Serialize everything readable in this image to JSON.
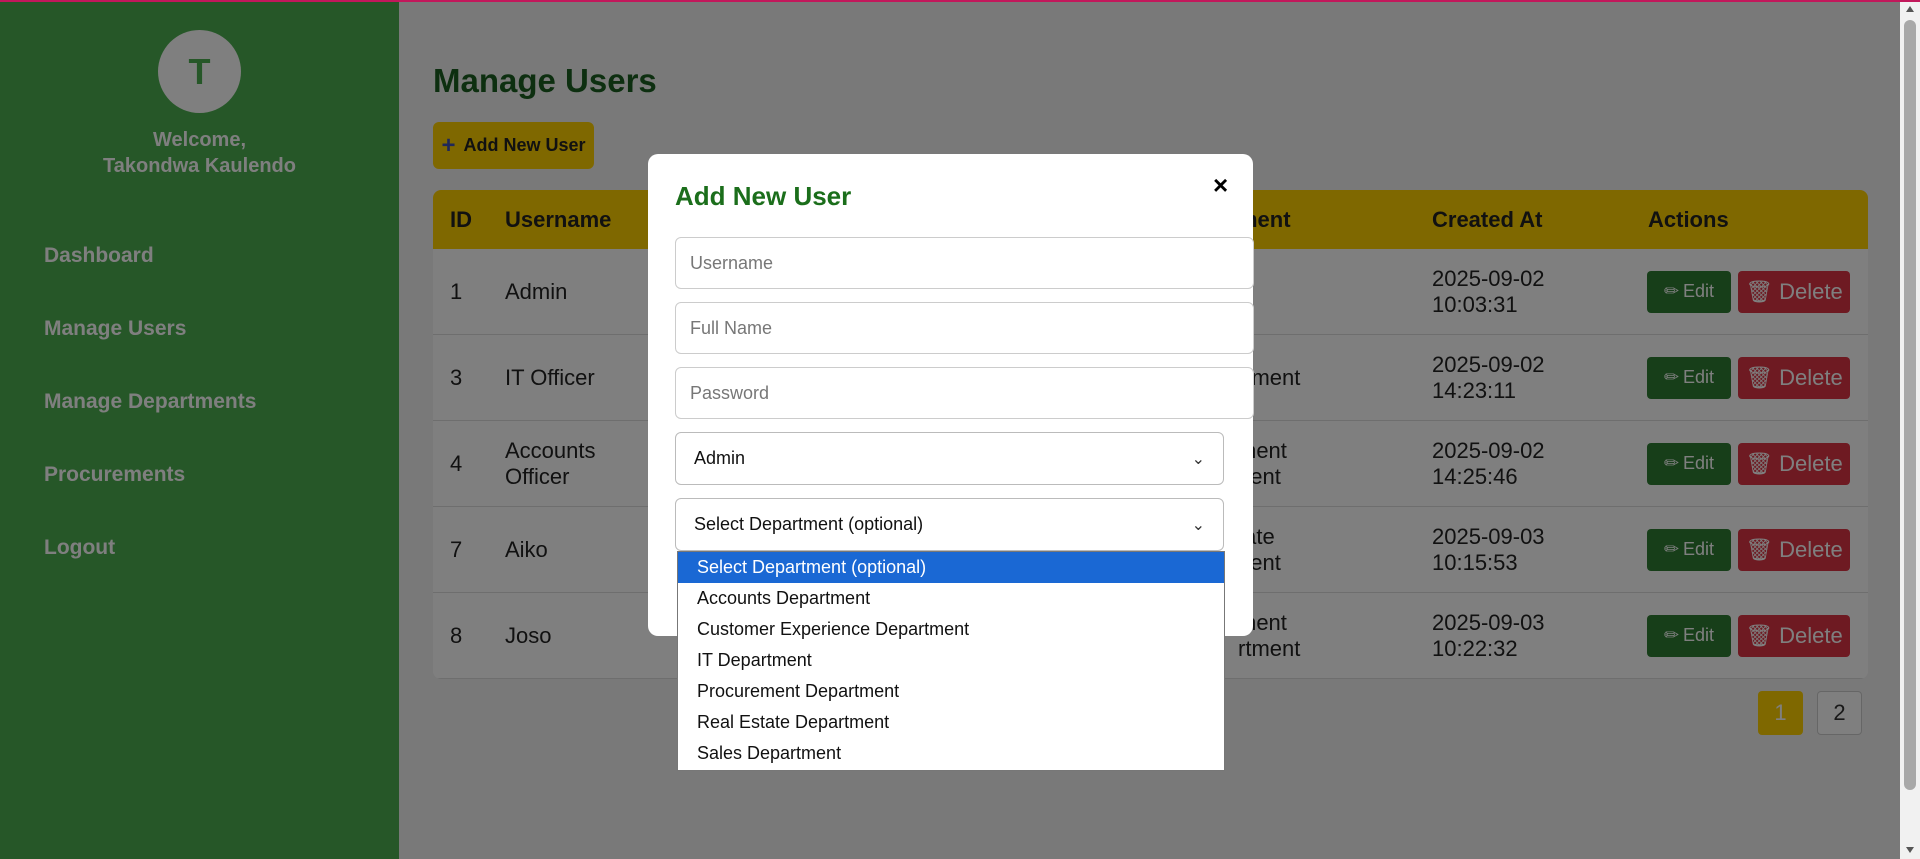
{
  "sidebar": {
    "avatar_initial": "T",
    "welcome_line1": "Welcome,",
    "welcome_line2": "Takondwa Kaulendo",
    "nav": [
      {
        "label": "Dashboard"
      },
      {
        "label": "Manage Users"
      },
      {
        "label": "Manage Departments"
      },
      {
        "label": "Procurements"
      },
      {
        "label": "Logout"
      }
    ]
  },
  "main": {
    "title": "Manage Users",
    "add_button": "Add New User",
    "table": {
      "headers": {
        "id": "ID",
        "username": "Username",
        "department_partial": "ment",
        "created_at": "Created At",
        "actions": "Actions"
      },
      "rows": [
        {
          "id": "1",
          "username": "Admin",
          "username2": "",
          "dept1": "",
          "dept2": "",
          "date": "2025-09-02",
          "time": "10:03:31"
        },
        {
          "id": "3",
          "username": "IT Officer",
          "username2": "",
          "dept1": "rtment",
          "dept2": "",
          "date": "2025-09-02",
          "time": "14:23:11"
        },
        {
          "id": "4",
          "username": "Accounts",
          "username2": "Officer",
          "dept1": "ment",
          "dept2": "nent",
          "date": "2025-09-02",
          "time": "14:25:46"
        },
        {
          "id": "7",
          "username": "Aiko",
          "username2": "",
          "dept1": "tate",
          "dept2": "nent",
          "date": "2025-09-03",
          "time": "10:15:53"
        },
        {
          "id": "8",
          "username": "Joso",
          "username2": "",
          "dept1": "ment",
          "dept2": "rtment",
          "date": "2025-09-03",
          "time": "10:22:32"
        }
      ],
      "edit_label": "Edit",
      "delete_label": "Delete"
    },
    "pagination": {
      "page1": "1",
      "page2": "2",
      "current": 1
    }
  },
  "modal": {
    "title": "Add New User",
    "close": "×",
    "username_placeholder": "Username",
    "fullname_placeholder": "Full Name",
    "password_placeholder": "Password",
    "role_selected": "Admin",
    "department_selected": "Select Department (optional)",
    "department_options": [
      "Select Department (optional)",
      "Accounts Department",
      "Customer Experience Department",
      "IT Department",
      "Procurement Department",
      "Real Estate Department",
      "Sales Department"
    ]
  },
  "colors": {
    "sidebar": "#4caf50",
    "accent": "#ffd000",
    "edit": "#2e7d32",
    "delete": "#dc3545",
    "title": "#1b5e20",
    "option_selected": "#1a68d4"
  }
}
